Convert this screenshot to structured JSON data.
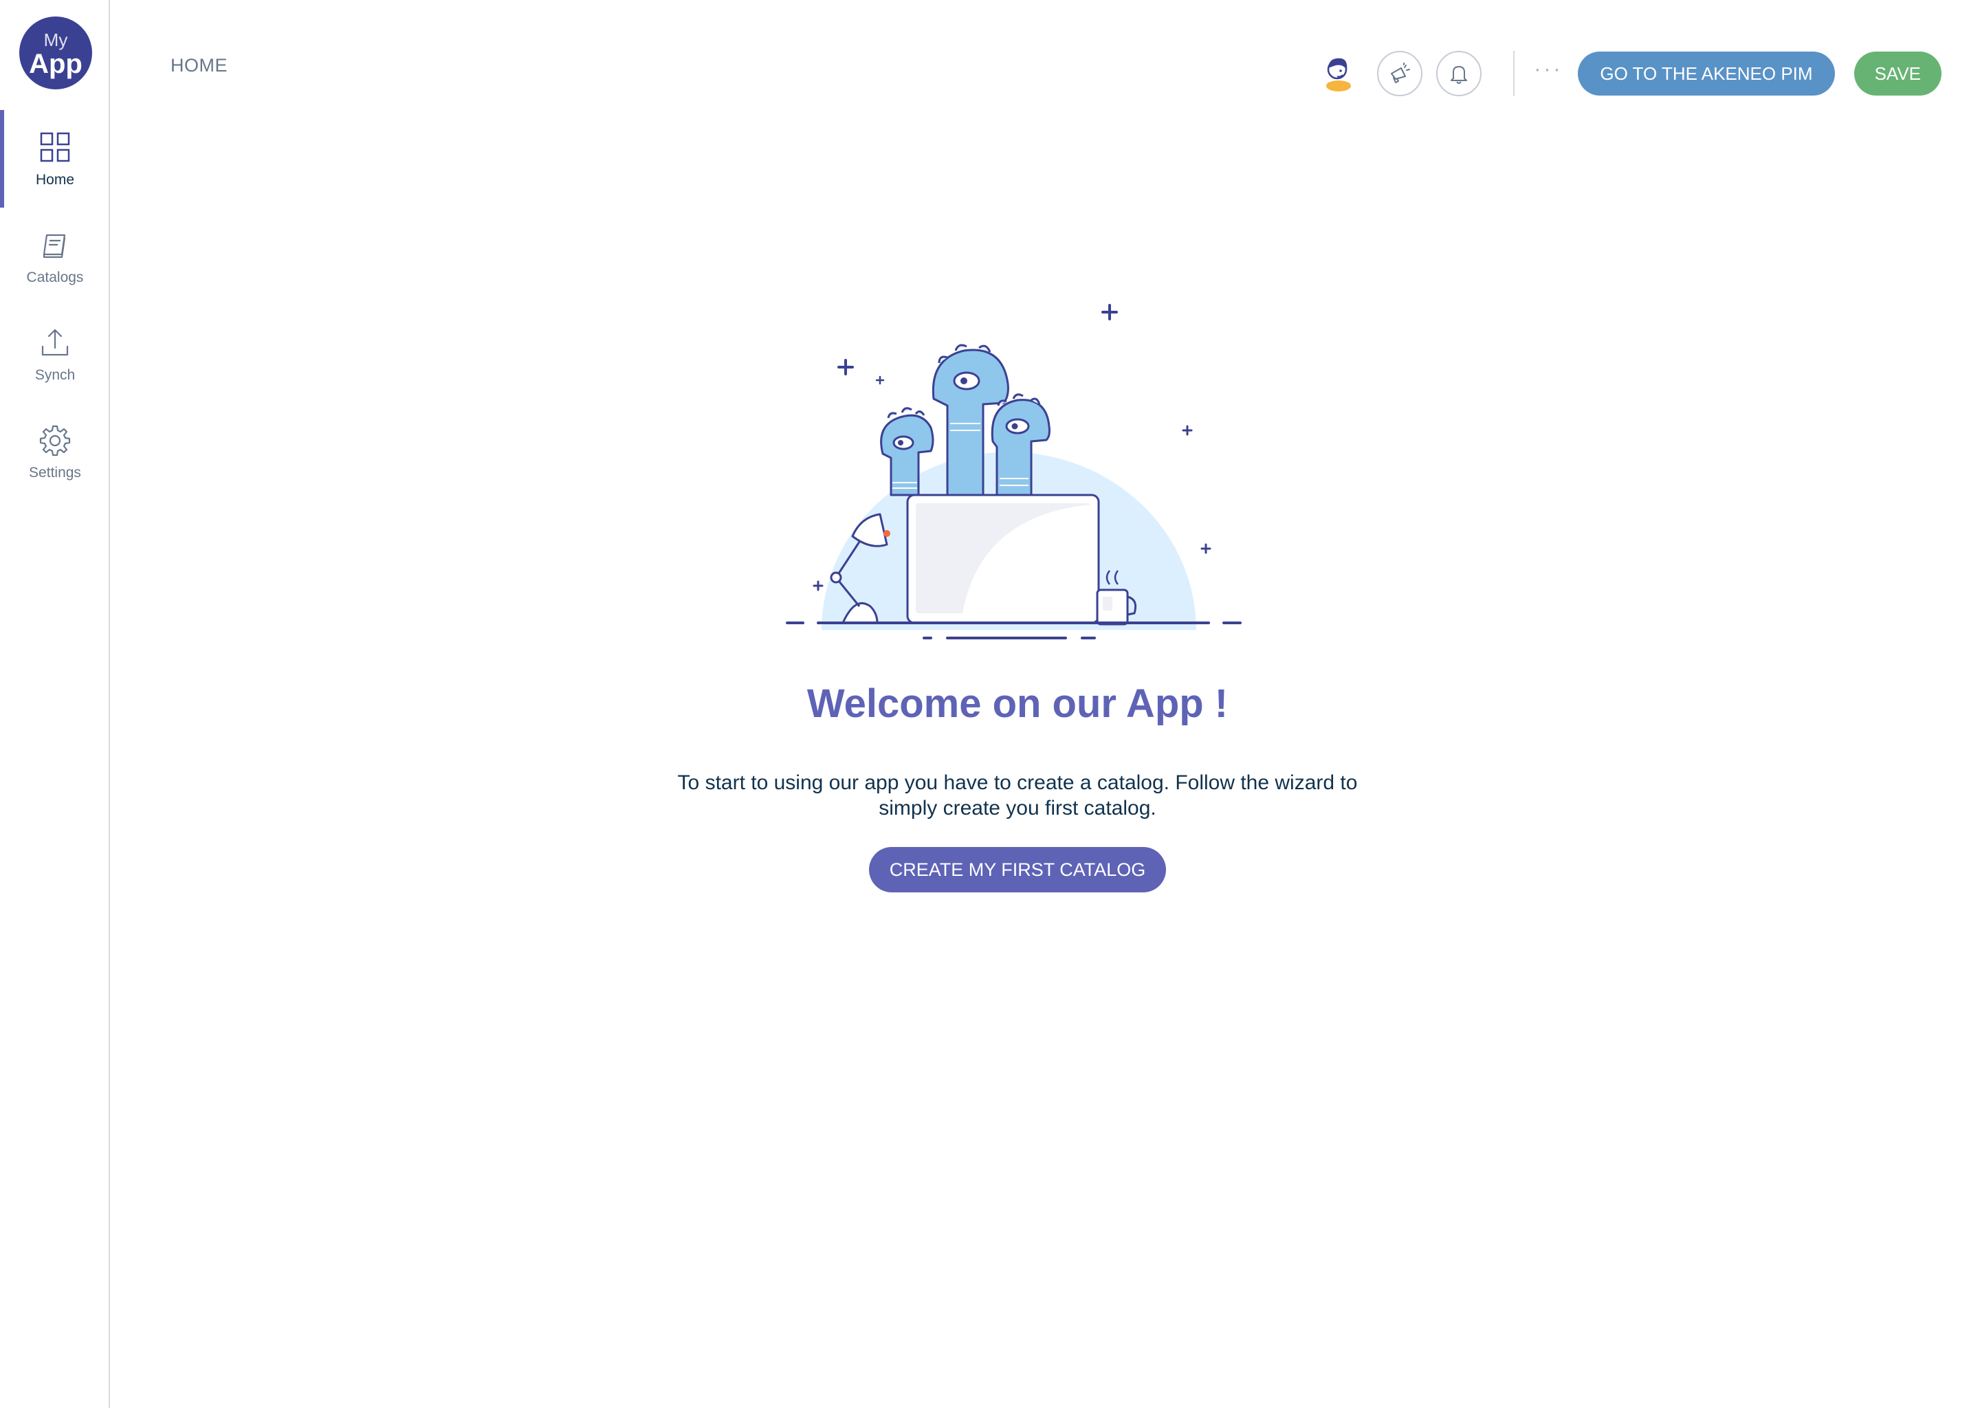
{
  "logo": {
    "line1": "My",
    "line2": "App"
  },
  "sidebar": {
    "items": [
      {
        "label": "Home",
        "icon": "grid-icon",
        "active": true
      },
      {
        "label": "Catalogs",
        "icon": "book-icon",
        "active": false
      },
      {
        "label": "Synch",
        "icon": "upload-icon",
        "active": false
      },
      {
        "label": "Settings",
        "icon": "gear-icon",
        "active": false
      }
    ]
  },
  "header": {
    "breadcrumb": "HOME",
    "more_label": "···",
    "pim_button": "GO TO THE AKENEO PIM",
    "save_button": "SAVE",
    "icons": [
      "avatar-icon",
      "megaphone-icon",
      "bell-icon"
    ]
  },
  "main": {
    "welcome_title": "Welcome on our App !",
    "description": "To start to using our app you have to create a catalog. Follow the wizard to simply create you first catalog.",
    "cta_button": "CREATE MY FIRST CATALOG"
  },
  "colors": {
    "brand_dark": "#3b4192",
    "accent": "#5e63b6",
    "pim_blue": "#5992c7",
    "save_green": "#67b373",
    "text": "#11324d",
    "muted": "#67768a"
  }
}
